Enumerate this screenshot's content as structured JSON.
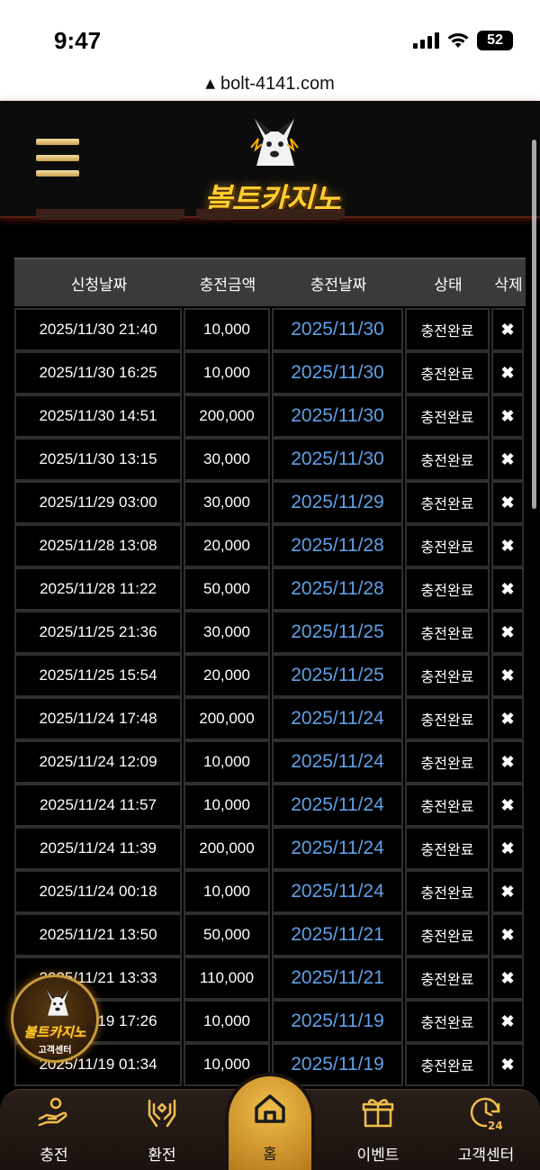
{
  "status_bar": {
    "time": "9:47",
    "battery": "52"
  },
  "address_bar": {
    "url": "bolt-4141.com"
  },
  "header": {
    "logo_text": "볼트카지노"
  },
  "table": {
    "columns": [
      "신청날짜",
      "충전금액",
      "충전날짜",
      "상태",
      "삭제"
    ],
    "rows": [
      {
        "requested": "2025/11/30 21:40",
        "amount": "10,000",
        "charged": "2025/11/30",
        "status": "충전완료"
      },
      {
        "requested": "2025/11/30 16:25",
        "amount": "10,000",
        "charged": "2025/11/30",
        "status": "충전완료"
      },
      {
        "requested": "2025/11/30 14:51",
        "amount": "200,000",
        "charged": "2025/11/30",
        "status": "충전완료"
      },
      {
        "requested": "2025/11/30 13:15",
        "amount": "30,000",
        "charged": "2025/11/30",
        "status": "충전완료"
      },
      {
        "requested": "2025/11/29 03:00",
        "amount": "30,000",
        "charged": "2025/11/29",
        "status": "충전완료"
      },
      {
        "requested": "2025/11/28 13:08",
        "amount": "20,000",
        "charged": "2025/11/28",
        "status": "충전완료"
      },
      {
        "requested": "2025/11/28 11:22",
        "amount": "50,000",
        "charged": "2025/11/28",
        "status": "충전완료"
      },
      {
        "requested": "2025/11/25 21:36",
        "amount": "30,000",
        "charged": "2025/11/25",
        "status": "충전완료"
      },
      {
        "requested": "2025/11/25 15:54",
        "amount": "20,000",
        "charged": "2025/11/25",
        "status": "충전완료"
      },
      {
        "requested": "2025/11/24 17:48",
        "amount": "200,000",
        "charged": "2025/11/24",
        "status": "충전완료"
      },
      {
        "requested": "2025/11/24 12:09",
        "amount": "10,000",
        "charged": "2025/11/24",
        "status": "충전완료"
      },
      {
        "requested": "2025/11/24 11:57",
        "amount": "10,000",
        "charged": "2025/11/24",
        "status": "충전완료"
      },
      {
        "requested": "2025/11/24 11:39",
        "amount": "200,000",
        "charged": "2025/11/24",
        "status": "충전완료"
      },
      {
        "requested": "2025/11/24 00:18",
        "amount": "10,000",
        "charged": "2025/11/24",
        "status": "충전완료"
      },
      {
        "requested": "2025/11/21 13:50",
        "amount": "50,000",
        "charged": "2025/11/21",
        "status": "충전완료"
      },
      {
        "requested": "2025/11/21 13:33",
        "amount": "110,000",
        "charged": "2025/11/21",
        "status": "충전완료"
      },
      {
        "requested": "2025/11/19 17:26",
        "amount": "10,000",
        "charged": "2025/11/19",
        "status": "충전완료"
      },
      {
        "requested": "2025/11/19 01:34",
        "amount": "10,000",
        "charged": "2025/11/19",
        "status": "충전완료"
      }
    ],
    "delete_glyph": "✖"
  },
  "support_badge": {
    "brand": "볼트카지노",
    "label": "고객센터"
  },
  "bottom_nav": {
    "items": [
      {
        "label": "충전",
        "icon": "hand-coin-icon"
      },
      {
        "label": "환전",
        "icon": "exchange-hands-icon"
      },
      {
        "label": "홈",
        "icon": "home-icon"
      },
      {
        "label": "이벤트",
        "icon": "gift-icon"
      },
      {
        "label": "고객센터",
        "icon": "support-24-icon"
      }
    ]
  },
  "colors": {
    "accent_gold": "#f0be4a",
    "link_blue": "#5fa0e6",
    "header_glow": "#aa2814"
  }
}
